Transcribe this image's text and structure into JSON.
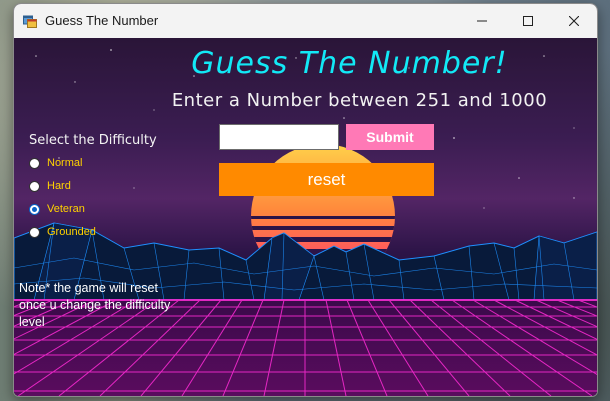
{
  "window": {
    "title": "Guess The Number",
    "icon": "app-window-icon",
    "controls": [
      "minimize-icon",
      "maximize-icon",
      "close-icon"
    ]
  },
  "game": {
    "heading": "Guess The Number!",
    "subheading": "Enter a Number between 251 and 1000",
    "input_value": "",
    "submit_label": "Submit",
    "reset_label": "reset"
  },
  "difficulty": {
    "label": "Select the Difficulty",
    "options": [
      {
        "label": "Normal",
        "selected": false
      },
      {
        "label": "Hard",
        "selected": false
      },
      {
        "label": "Veteran",
        "selected": true
      },
      {
        "label": "Grounded",
        "selected": false
      }
    ]
  },
  "note": "Note* the game will reset once u change the difficulty level",
  "colors": {
    "heading": "#12e9f6",
    "difficulty_options": "#ffd200",
    "submit_button": "#ff79b6",
    "reset_button": "#ff8a00",
    "grid_lines": "#ff2bd6",
    "mountain_lines": "#1e90ff"
  }
}
